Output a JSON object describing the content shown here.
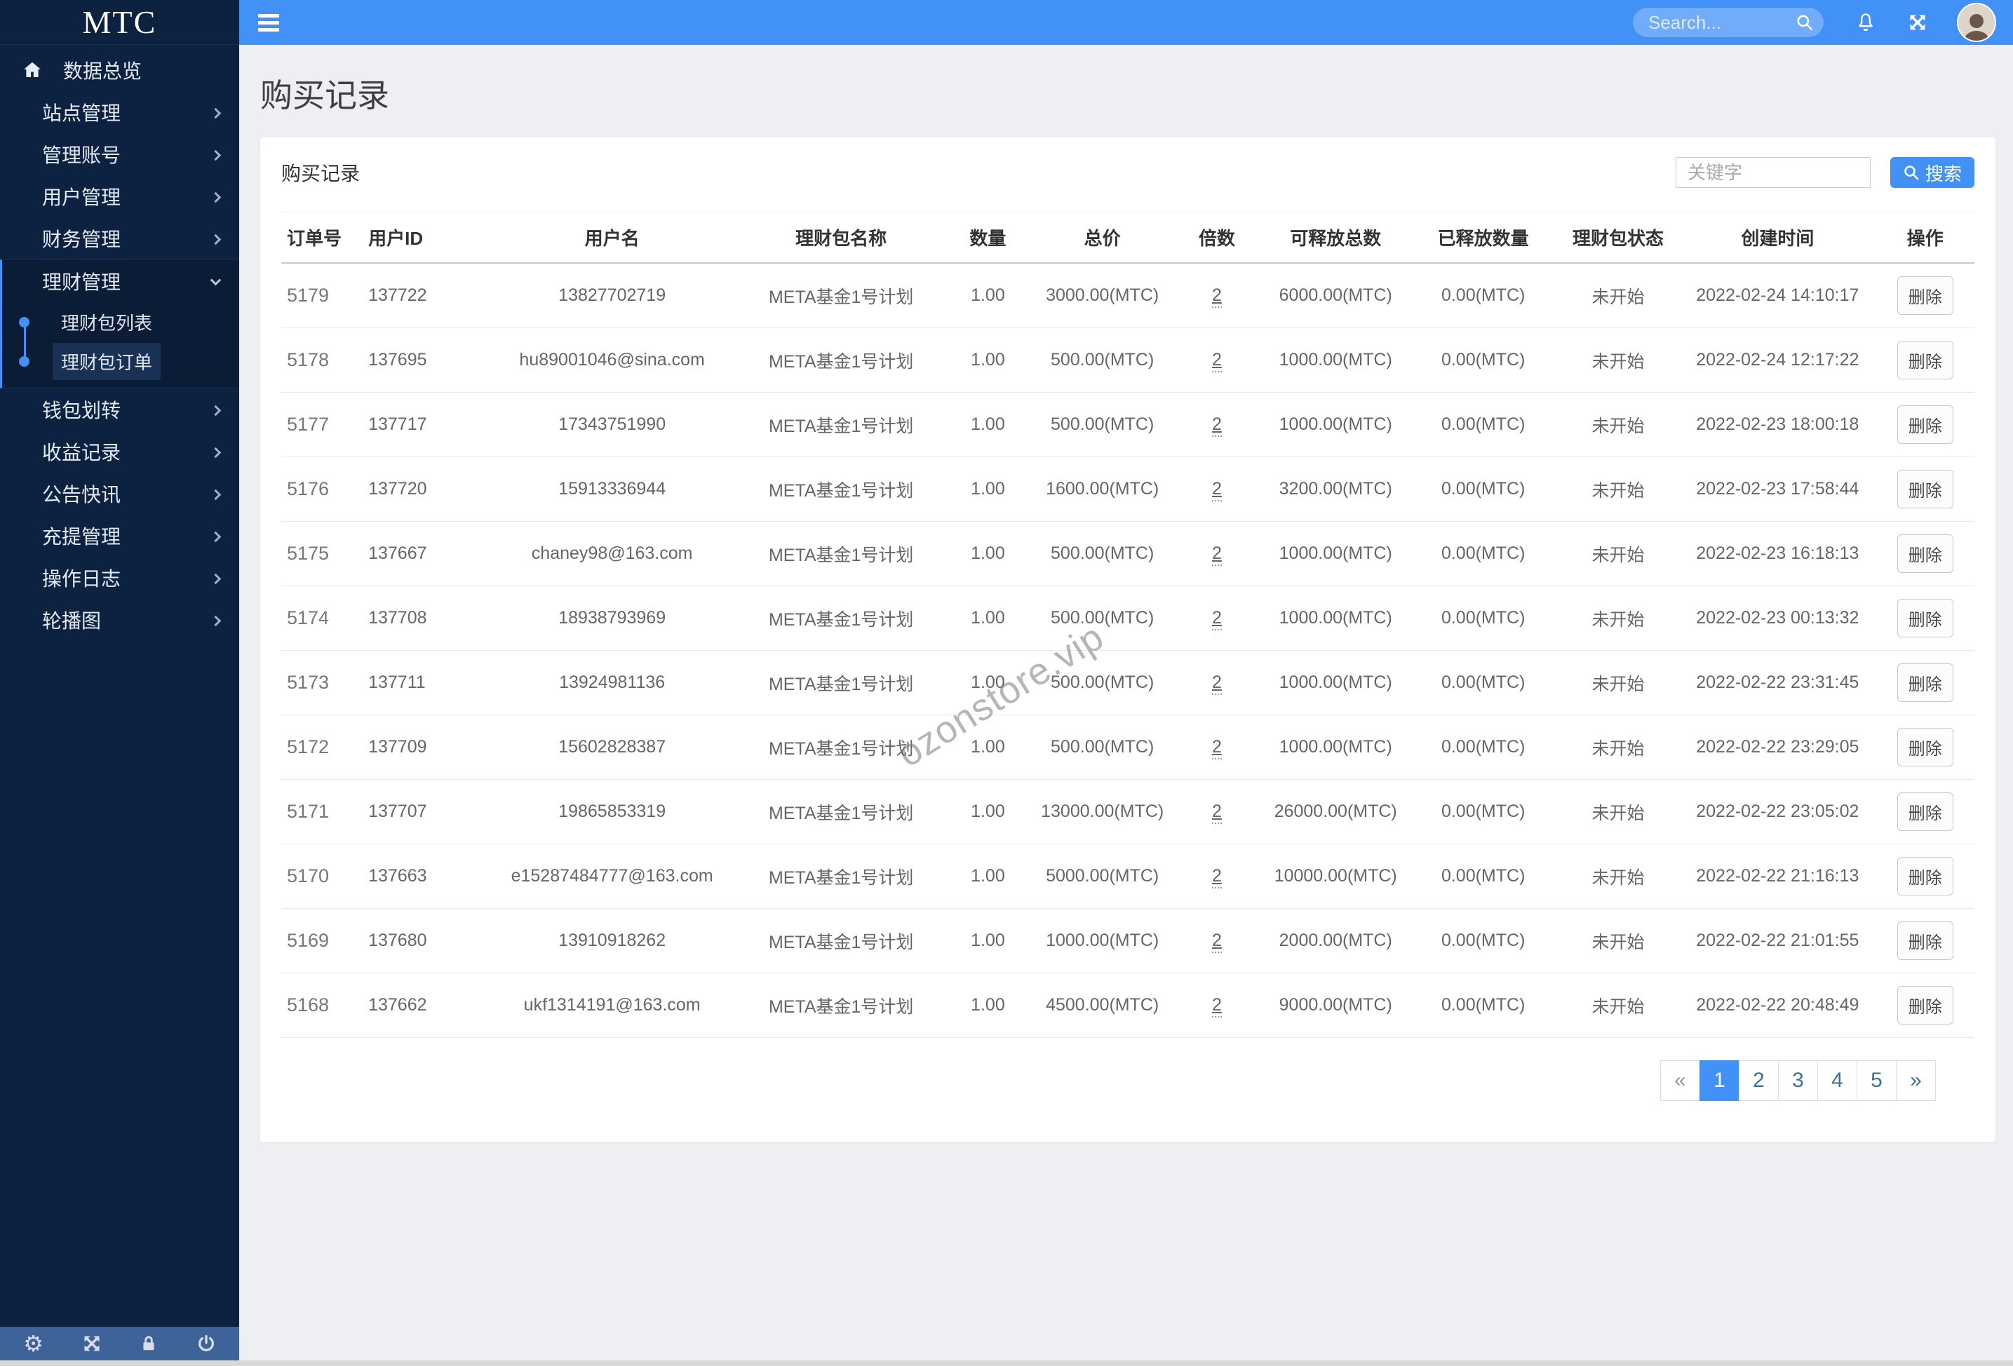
{
  "app": {
    "logo": "MTC"
  },
  "colors": {
    "accent": "#4191f6",
    "sidebar_bg": "#0d2240",
    "main_bg": "#edeff3"
  },
  "topbar": {
    "search_placeholder": "Search...",
    "icons": [
      "search-icon",
      "bell-icon",
      "fullscreen-icon",
      "avatar"
    ]
  },
  "sidebar": {
    "items": [
      {
        "label": "数据总览",
        "type": "link",
        "icon": "home"
      },
      {
        "label": "站点管理",
        "type": "parent"
      },
      {
        "label": "管理账号",
        "type": "parent"
      },
      {
        "label": "用户管理",
        "type": "parent"
      },
      {
        "label": "财务管理",
        "type": "parent"
      },
      {
        "label": "理财管理",
        "type": "group",
        "expanded": true,
        "children": [
          {
            "label": "理财包列表",
            "active": false
          },
          {
            "label": "理财包订单",
            "active": true
          }
        ]
      },
      {
        "label": "钱包划转",
        "type": "parent"
      },
      {
        "label": "收益记录",
        "type": "parent"
      },
      {
        "label": "公告快讯",
        "type": "parent"
      },
      {
        "label": "充提管理",
        "type": "parent"
      },
      {
        "label": "操作日志",
        "type": "parent"
      },
      {
        "label": "轮播图",
        "type": "parent"
      }
    ],
    "footer_icons": [
      "gear-icon",
      "fullscreen-icon",
      "lock-icon",
      "power-icon"
    ]
  },
  "page": {
    "title": "购买记录"
  },
  "card": {
    "title": "购买记录",
    "keyword_placeholder": "关键字",
    "search_button_label": "搜索"
  },
  "table": {
    "columns": [
      {
        "key": "order_no",
        "label": "订单号",
        "align": "left",
        "width": "4.8%"
      },
      {
        "key": "user_id",
        "label": "用户ID",
        "align": "left",
        "width": "7.2%"
      },
      {
        "key": "username",
        "label": "用户名",
        "align": "center",
        "width": "15%"
      },
      {
        "key": "package_name",
        "label": "理财包名称",
        "align": "center",
        "width": "12%"
      },
      {
        "key": "quantity",
        "label": "数量",
        "align": "center",
        "width": "5.3%"
      },
      {
        "key": "total_price",
        "label": "总价",
        "align": "center",
        "width": "8.2%"
      },
      {
        "key": "multiple",
        "label": "倍数",
        "align": "center",
        "width": "5.3%"
      },
      {
        "key": "releasable_total",
        "label": "可释放总数",
        "align": "center",
        "width": "8.7%"
      },
      {
        "key": "released_amount",
        "label": "已释放数量",
        "align": "center",
        "width": "8.7%"
      },
      {
        "key": "package_status",
        "label": "理财包状态",
        "align": "center",
        "width": "7.2%"
      },
      {
        "key": "created_at",
        "label": "创建时间",
        "align": "center",
        "width": "11.6%"
      },
      {
        "key": "action",
        "label": "操作",
        "align": "center",
        "width": "5.8%"
      }
    ],
    "delete_label": "删除",
    "rows": [
      {
        "order_no": "5179",
        "user_id": "137722",
        "username": "13827702719",
        "package_name": "META基金1号计划",
        "quantity": "1.00",
        "total_price": "3000.00(MTC)",
        "multiple": "2",
        "releasable_total": "6000.00(MTC)",
        "released_amount": "0.00(MTC)",
        "package_status": "未开始",
        "created_at": "2022-02-24 14:10:17"
      },
      {
        "order_no": "5178",
        "user_id": "137695",
        "username": "hu89001046@sina.com",
        "package_name": "META基金1号计划",
        "quantity": "1.00",
        "total_price": "500.00(MTC)",
        "multiple": "2",
        "releasable_total": "1000.00(MTC)",
        "released_amount": "0.00(MTC)",
        "package_status": "未开始",
        "created_at": "2022-02-24 12:17:22"
      },
      {
        "order_no": "5177",
        "user_id": "137717",
        "username": "17343751990",
        "package_name": "META基金1号计划",
        "quantity": "1.00",
        "total_price": "500.00(MTC)",
        "multiple": "2",
        "releasable_total": "1000.00(MTC)",
        "released_amount": "0.00(MTC)",
        "package_status": "未开始",
        "created_at": "2022-02-23 18:00:18"
      },
      {
        "order_no": "5176",
        "user_id": "137720",
        "username": "15913336944",
        "package_name": "META基金1号计划",
        "quantity": "1.00",
        "total_price": "1600.00(MTC)",
        "multiple": "2",
        "releasable_total": "3200.00(MTC)",
        "released_amount": "0.00(MTC)",
        "package_status": "未开始",
        "created_at": "2022-02-23 17:58:44"
      },
      {
        "order_no": "5175",
        "user_id": "137667",
        "username": "chaney98@163.com",
        "package_name": "META基金1号计划",
        "quantity": "1.00",
        "total_price": "500.00(MTC)",
        "multiple": "2",
        "releasable_total": "1000.00(MTC)",
        "released_amount": "0.00(MTC)",
        "package_status": "未开始",
        "created_at": "2022-02-23 16:18:13"
      },
      {
        "order_no": "5174",
        "user_id": "137708",
        "username": "18938793969",
        "package_name": "META基金1号计划",
        "quantity": "1.00",
        "total_price": "500.00(MTC)",
        "multiple": "2",
        "releasable_total": "1000.00(MTC)",
        "released_amount": "0.00(MTC)",
        "package_status": "未开始",
        "created_at": "2022-02-23 00:13:32"
      },
      {
        "order_no": "5173",
        "user_id": "137711",
        "username": "13924981136",
        "package_name": "META基金1号计划",
        "quantity": "1.00",
        "total_price": "500.00(MTC)",
        "multiple": "2",
        "releasable_total": "1000.00(MTC)",
        "released_amount": "0.00(MTC)",
        "package_status": "未开始",
        "created_at": "2022-02-22 23:31:45"
      },
      {
        "order_no": "5172",
        "user_id": "137709",
        "username": "15602828387",
        "package_name": "META基金1号计划",
        "quantity": "1.00",
        "total_price": "500.00(MTC)",
        "multiple": "2",
        "releasable_total": "1000.00(MTC)",
        "released_amount": "0.00(MTC)",
        "package_status": "未开始",
        "created_at": "2022-02-22 23:29:05"
      },
      {
        "order_no": "5171",
        "user_id": "137707",
        "username": "19865853319",
        "package_name": "META基金1号计划",
        "quantity": "1.00",
        "total_price": "13000.00(MTC)",
        "multiple": "2",
        "releasable_total": "26000.00(MTC)",
        "released_amount": "0.00(MTC)",
        "package_status": "未开始",
        "created_at": "2022-02-22 23:05:02"
      },
      {
        "order_no": "5170",
        "user_id": "137663",
        "username": "e15287484777@163.com",
        "package_name": "META基金1号计划",
        "quantity": "1.00",
        "total_price": "5000.00(MTC)",
        "multiple": "2",
        "releasable_total": "10000.00(MTC)",
        "released_amount": "0.00(MTC)",
        "package_status": "未开始",
        "created_at": "2022-02-22 21:16:13"
      },
      {
        "order_no": "5169",
        "user_id": "137680",
        "username": "13910918262",
        "package_name": "META基金1号计划",
        "quantity": "1.00",
        "total_price": "1000.00(MTC)",
        "multiple": "2",
        "releasable_total": "2000.00(MTC)",
        "released_amount": "0.00(MTC)",
        "package_status": "未开始",
        "created_at": "2022-02-22 21:01:55"
      },
      {
        "order_no": "5168",
        "user_id": "137662",
        "username": "ukf1314191@163.com",
        "package_name": "META基金1号计划",
        "quantity": "1.00",
        "total_price": "4500.00(MTC)",
        "multiple": "2",
        "releasable_total": "9000.00(MTC)",
        "released_amount": "0.00(MTC)",
        "package_status": "未开始",
        "created_at": "2022-02-22 20:48:49"
      }
    ]
  },
  "pagination": {
    "prev": "«",
    "pages": [
      "1",
      "2",
      "3",
      "4",
      "5"
    ],
    "active": "1",
    "next": "»"
  },
  "watermark": "ozonstore.vip"
}
